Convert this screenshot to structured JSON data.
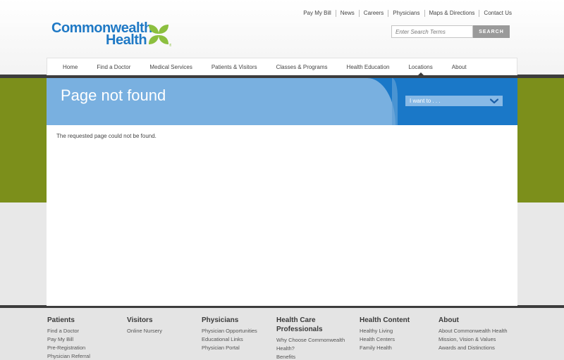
{
  "logo": {
    "line1": "Commonwealth",
    "line2": "Health",
    "registered": "®",
    "colors": {
      "blue": "#1f79c5",
      "green": "#8cbf3f"
    }
  },
  "utility_nav": [
    "Pay My Bill",
    "News",
    "Careers",
    "Physicians",
    "Maps & Directions",
    "Contact Us"
  ],
  "search": {
    "placeholder": "Enter Search Terms",
    "button_label": "SEARCH"
  },
  "main_nav": {
    "items": [
      {
        "label": "Home"
      },
      {
        "label": "Find a Doctor"
      },
      {
        "label": "Medical Services"
      },
      {
        "label": "Patients & Visitors"
      },
      {
        "label": "Classes & Programs"
      },
      {
        "label": "Health Education"
      },
      {
        "label": "Locations",
        "active": true
      },
      {
        "label": "About"
      }
    ]
  },
  "page": {
    "title": "Page not found",
    "i_want_to": "I want to . . .",
    "message": "The requested page could not be found."
  },
  "footer": {
    "columns": [
      {
        "heading": "Patients",
        "links": [
          "Find a Doctor",
          "Pay My Bill",
          "Pre-Registration",
          "Physician Referral"
        ]
      },
      {
        "heading": "Visitors",
        "links": [
          "Online Nursery"
        ]
      },
      {
        "heading": "Physicians",
        "links": [
          "Physician Opportunities",
          "Educational Links",
          "Physician Portal"
        ]
      },
      {
        "heading": "Health Care Professionals",
        "links": [
          "Why Choose Commonwealth Health?",
          "Benefits"
        ]
      },
      {
        "heading": "Health Content",
        "links": [
          "Healthy Living",
          "Health Centers",
          "Family Health"
        ]
      },
      {
        "heading": "About",
        "links": [
          "About Commonwealth Health",
          "Mission, Vision & Values",
          "Awards and Distinctions"
        ]
      }
    ]
  },
  "colors": {
    "banner_blue": "#1a78c8",
    "banner_light": "#79b0e0",
    "olive_band": "#7c8f1b",
    "dark_band": "#3c3c3c"
  }
}
